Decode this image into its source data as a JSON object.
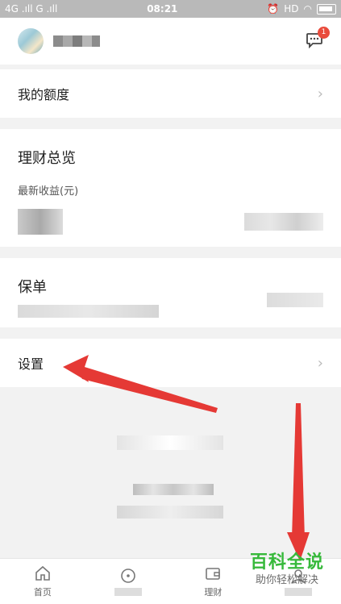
{
  "status_bar": {
    "left": "4G .ıll G .ıll",
    "time": "08:21",
    "right": "HD"
  },
  "header": {
    "message_badge": "1"
  },
  "rows": {
    "quota": {
      "label": "我的额度"
    },
    "settings": {
      "label": "设置"
    }
  },
  "finance": {
    "title": "理财总览",
    "subtitle": "最新收益(元)"
  },
  "policy": {
    "title": "保单"
  },
  "tabbar": {
    "items": [
      {
        "label": "首页"
      },
      {
        "label": ""
      },
      {
        "label": "理财"
      },
      {
        "label": ""
      }
    ]
  },
  "watermark": {
    "main": "百科全说",
    "sub": "助你轻松解决"
  },
  "colors": {
    "accent_red": "#e94b3c",
    "watermark_green": "#37b93b"
  }
}
